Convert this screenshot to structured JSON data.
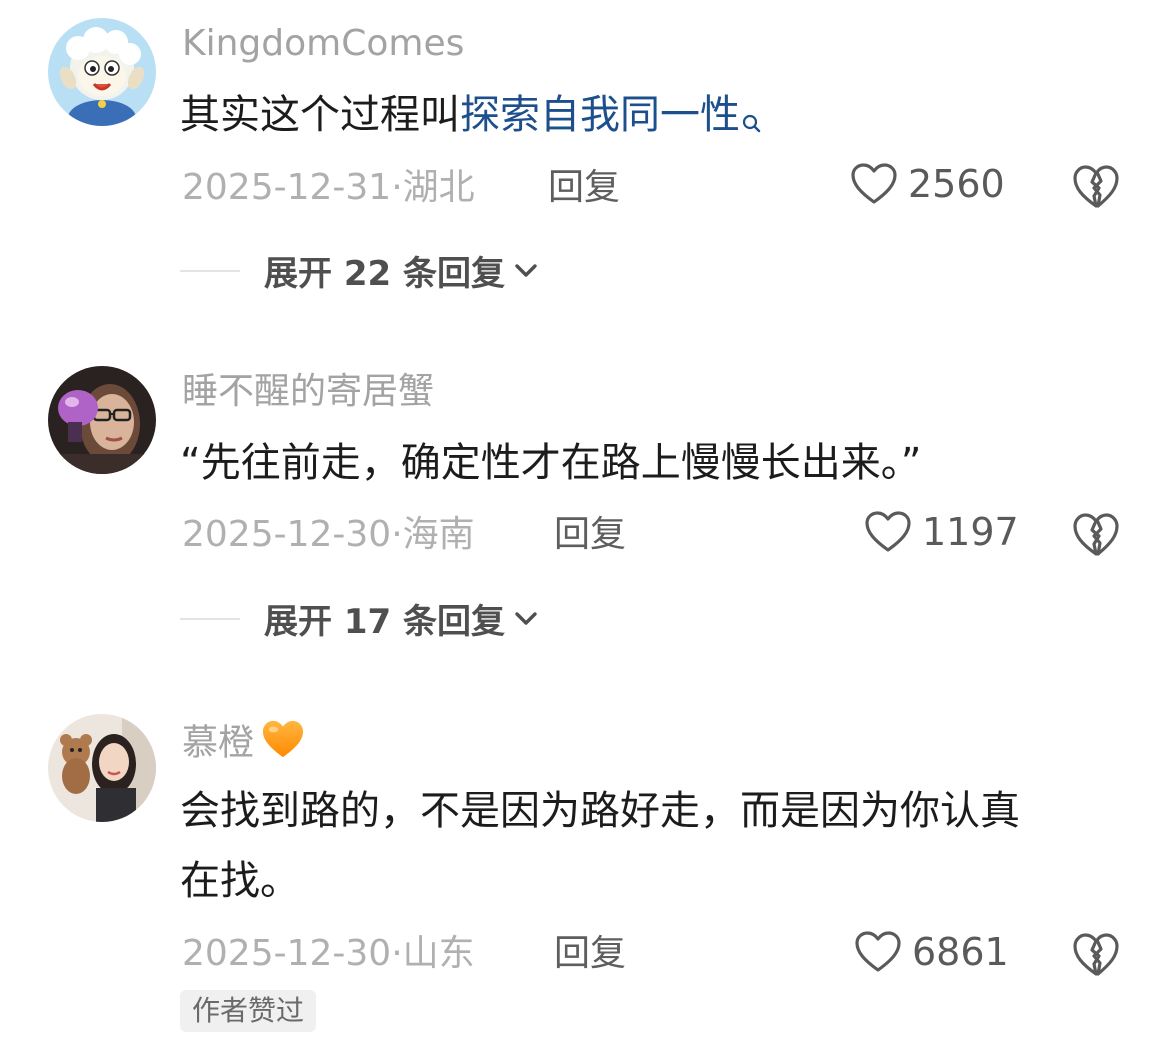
{
  "comments": [
    {
      "username": "KingdomComes",
      "text_prefix": "其实这个过程叫",
      "text_link": "探索自我同一性",
      "text_line2": "",
      "date": "2025-12-31",
      "location": "湖北",
      "reply_label": "回复",
      "likes": "2560",
      "expand_label": "展开 22 条回复",
      "avatar_icon": "sheep-cartoon-avatar"
    },
    {
      "username": "睡不醒的寄居蟹",
      "text_prefix": "“先往前走，确定性才在路上慢慢长出来。”",
      "date": "2025-12-30",
      "location": "海南",
      "reply_label": "回复",
      "likes": "1197",
      "expand_label": "展开 17 条回复",
      "avatar_icon": "woman-glasses-photo-avatar"
    },
    {
      "username": "慕橙",
      "text_prefix": "会找到路的，不是因为路好走，而是因为你认真",
      "text_line2": "在找。",
      "date": "2025-12-30",
      "location": "山东",
      "reply_label": "回复",
      "likes": "6861",
      "badge": "作者赞过",
      "avatar_icon": "woman-teddy-photo-avatar"
    }
  ],
  "colors": {
    "link": "#1d4f8c",
    "meta": "#b0b0b0",
    "username": "#a3a3a3",
    "heart_emoji": "#ff9a1f"
  },
  "icons": [
    "heart-outline-icon",
    "broken-heart-icon",
    "search-icon",
    "chevron-down-icon",
    "orange-heart-emoji"
  ]
}
